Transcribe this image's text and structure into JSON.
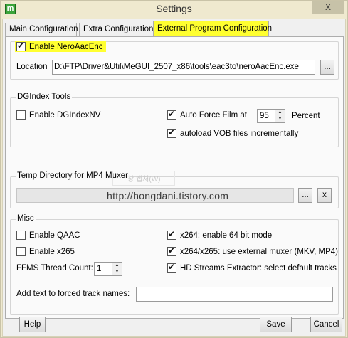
{
  "window": {
    "title": "Settings",
    "app_icon": "megui-icon",
    "close_symbol": "X"
  },
  "tabs": [
    {
      "label": "Main Configuration"
    },
    {
      "label": "Extra Configuration"
    },
    {
      "label": "External Program Configuration",
      "active": true
    }
  ],
  "nero": {
    "enable_label": "Enable NeroAacEnc",
    "enable_checked": true,
    "location_label": "Location",
    "location_value": "D:\\FTP\\Driver&Util\\MeGUI_2507_x86\\tools\\eac3to\\neroAacEnc.exe",
    "browse_label": "..."
  },
  "dgindex": {
    "title": "DGIndex Tools",
    "enable_dgindexnv_label": "Enable DGIndexNV",
    "enable_dgindexnv_checked": false,
    "auto_force_film_label": "Auto Force Film at",
    "auto_force_film_checked": true,
    "auto_force_film_value": "95",
    "percent_label": "Percent",
    "autoload_vob_label": "autoload VOB files incrementally",
    "autoload_vob_checked": true
  },
  "temp_dir": {
    "title": "Temp Directory for MP4 Muxer",
    "value": "",
    "browse_label": "...",
    "clear_label": "x"
  },
  "misc": {
    "title": "Misc",
    "enable_qaac_label": "Enable QAAC",
    "enable_qaac_checked": false,
    "enable_x265_label": "Enable x265",
    "enable_x265_checked": false,
    "ffms_label": "FFMS Thread Count:",
    "ffms_value": "1",
    "x264_64bit_label": "x264: enable 64 bit mode",
    "x264_64bit_checked": true,
    "external_muxer_label": "x264/x265: use external muxer (MKV, MP4)",
    "external_muxer_checked": true,
    "hd_streams_label": "HD Streams Extractor: select default tracks",
    "hd_streams_checked": true,
    "forced_track_label": "Add text to forced track names:",
    "forced_track_value": ""
  },
  "watermark": {
    "url": "http://hongdani.tistory.com",
    "korean": "창 캡처(W)"
  },
  "footer": {
    "help_label": "Help",
    "save_label": "Save",
    "cancel_label": "Cancel"
  },
  "colors": {
    "highlight": "#ffff30",
    "title_bar": "#efe9cf"
  }
}
